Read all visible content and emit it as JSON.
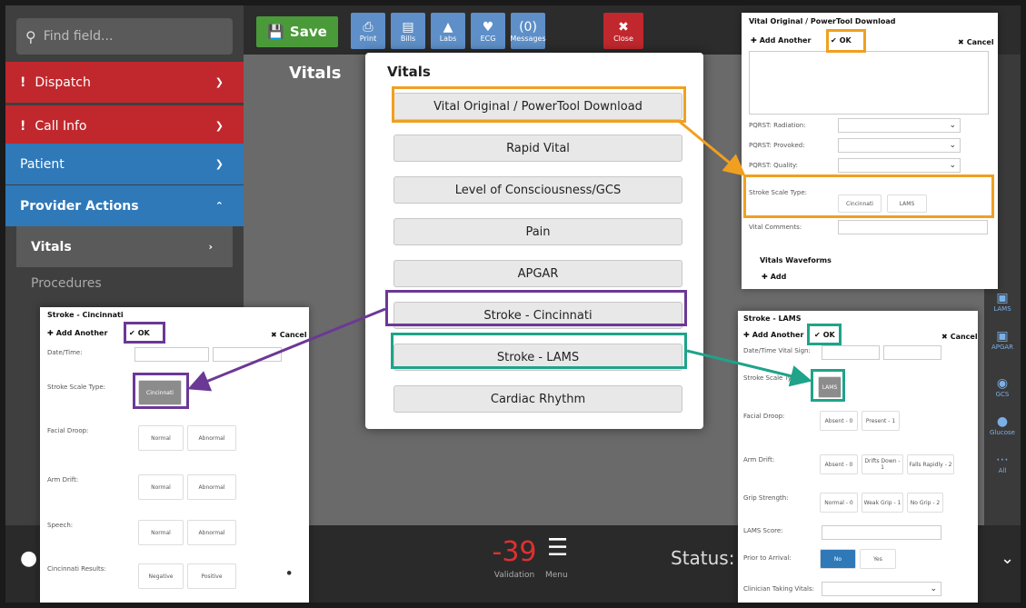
{
  "sidebar": {
    "search_placeholder": "Find field...",
    "items": [
      {
        "label": "Dispatch",
        "alert": "!"
      },
      {
        "label": "Call Info",
        "alert": "!"
      },
      {
        "label": "Patient",
        "alert": ""
      },
      {
        "label": "Provider Actions",
        "alert": ""
      },
      {
        "label": "Vitals",
        "alert": ""
      },
      {
        "label": "Procedures",
        "alert": ""
      }
    ]
  },
  "toolbar": {
    "save": "Save",
    "buttons": [
      "Print",
      "Bills",
      "Labs",
      "ECG",
      "Messages",
      "Close"
    ],
    "messages_count": "(0)"
  },
  "main": {
    "title": "Vitals",
    "validation_value": "-39",
    "validation_label": "Validation",
    "menu_label": "Menu",
    "status_label": "Status:"
  },
  "right_icons": [
    "LAMS",
    "APGAR",
    "GCS",
    "Glucose",
    "All"
  ],
  "modal": {
    "title": "Vitals",
    "options": [
      "Vital Original / PowerTool Download",
      "Rapid Vital",
      "Level of Consciousness/GCS",
      "Pain",
      "APGAR",
      "Stroke - Cincinnati",
      "Stroke - LAMS",
      "Cardiac Rhythm"
    ]
  },
  "panel_original": {
    "title": "Vital Original / PowerTool Download",
    "add": "Add Another",
    "ok": "OK",
    "cancel": "Cancel",
    "fields": [
      "PQRST: Radiation:",
      "PQRST: Provoked:",
      "PQRST: Quality:"
    ],
    "stroke_label": "Stroke Scale Type:",
    "stroke_options": [
      "Cincinnati",
      "LAMS"
    ],
    "comments_label": "Vital Comments:",
    "waveforms": "Vitals Waveforms",
    "add_btn": "Add"
  },
  "panel_cincinnati": {
    "title": "Stroke - Cincinnati",
    "add": "Add Another",
    "ok": "OK",
    "cancel": "Cancel",
    "date_label": "Date/Time:",
    "stroke_label": "Stroke Scale Type:",
    "stroke_value": "Cincinnati",
    "rows": [
      {
        "label": "Facial Droop:",
        "opts": [
          "Normal",
          "Abnormal"
        ]
      },
      {
        "label": "Arm Drift:",
        "opts": [
          "Normal",
          "Abnormal"
        ]
      },
      {
        "label": "Speech:",
        "opts": [
          "Normal",
          "Abnormal"
        ]
      },
      {
        "label": "Cincinnati Results:",
        "opts": [
          "Negative",
          "Positive"
        ]
      }
    ]
  },
  "panel_lams": {
    "title": "Stroke - LAMS",
    "add": "Add Another",
    "ok": "OK",
    "cancel": "Cancel",
    "date_label": "Date/Time Vital Sign:",
    "stroke_label": "Stroke Scale Type:",
    "stroke_value": "LAMS",
    "facial_label": "Facial Droop:",
    "facial_opts": [
      "Absent - 0",
      "Present - 1"
    ],
    "arm_label": "Arm Drift:",
    "arm_opts": [
      "Absent - 0",
      "Drifts Down - 1",
      "Falls Rapidly - 2"
    ],
    "grip_label": "Grip Strength:",
    "grip_opts": [
      "Normal - 0",
      "Weak Grip - 1",
      "No Grip - 2"
    ],
    "score_label": "LAMS Score:",
    "prior_label": "Prior to Arrival:",
    "prior_opts": [
      "No",
      "Yes"
    ],
    "clinician_label": "Clinician Taking Vitals:"
  },
  "colors": {
    "orange": "#f0a020",
    "purple": "#6c3896",
    "teal": "#1fa38a",
    "red": "#c0282d",
    "blue": "#2f79b9"
  }
}
